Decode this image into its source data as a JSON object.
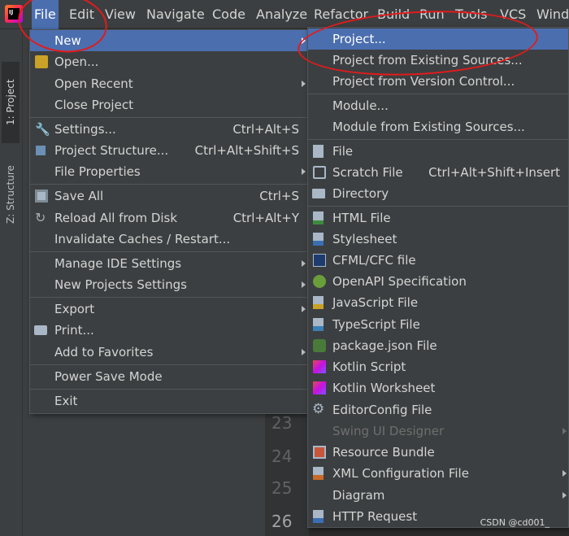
{
  "menubar": {
    "items": [
      "File",
      "Edit",
      "View",
      "Navigate",
      "Code",
      "Analyze",
      "Refactor",
      "Build",
      "Run",
      "Tools",
      "VCS",
      "Window"
    ]
  },
  "toolstrip": {
    "project_tab": "1: Project",
    "structure_tab": "Z: Structure"
  },
  "gutter": {
    "lines": [
      "23",
      "24",
      "25",
      "26"
    ]
  },
  "file_menu": {
    "new": "New",
    "open": "Open...",
    "open_recent": "Open Recent",
    "close_project": "Close Project",
    "settings": "Settings...",
    "settings_shortcut": "Ctrl+Alt+S",
    "project_structure": "Project Structure...",
    "project_structure_shortcut": "Ctrl+Alt+Shift+S",
    "file_properties": "File Properties",
    "save_all": "Save All",
    "save_all_shortcut": "Ctrl+S",
    "reload": "Reload All from Disk",
    "reload_shortcut": "Ctrl+Alt+Y",
    "invalidate": "Invalidate Caches / Restart...",
    "manage_ide": "Manage IDE Settings",
    "new_projects_settings": "New Projects Settings",
    "export": "Export",
    "print": "Print...",
    "add_favorites": "Add to Favorites",
    "power_save": "Power Save Mode",
    "exit": "Exit"
  },
  "new_menu": {
    "project": "Project...",
    "project_existing": "Project from Existing Sources...",
    "project_vcs": "Project from Version Control...",
    "module": "Module...",
    "module_existing": "Module from Existing Sources...",
    "file": "File",
    "scratch": "Scratch File",
    "scratch_shortcut": "Ctrl+Alt+Shift+Insert",
    "directory": "Directory",
    "html": "HTML File",
    "stylesheet": "Stylesheet",
    "cfml": "CFML/CFC file",
    "openapi": "OpenAPI Specification",
    "js": "JavaScript File",
    "ts": "TypeScript File",
    "packagejson": "package.json File",
    "kotlin_script": "Kotlin Script",
    "kotlin_worksheet": "Kotlin Worksheet",
    "editorconfig": "EditorConfig File",
    "swing": "Swing UI Designer",
    "resource_bundle": "Resource Bundle",
    "xml_config": "XML Configuration File",
    "diagram": "Diagram",
    "http_request": "HTTP Request"
  },
  "watermark": "CSDN @cd001_",
  "colors": {
    "highlight": "#4b6eaf",
    "menu_bg": "#3c3f41",
    "annotation": "#e21b1b"
  }
}
